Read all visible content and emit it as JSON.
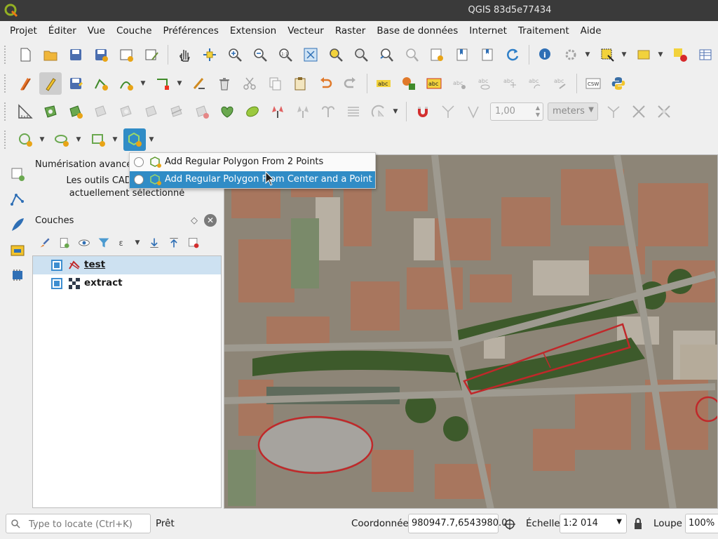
{
  "window": {
    "title": "QGIS 83d5e77434"
  },
  "menu": [
    "Projet",
    "Éditer",
    "Vue",
    "Couche",
    "Préférences",
    "Extension",
    "Vecteur",
    "Raster",
    "Base de données",
    "Internet",
    "Traitement",
    "Aide"
  ],
  "toolbar3": {
    "offset_value": "1,00",
    "units": "meters"
  },
  "cad_panel": {
    "title": "Numérisation avancée",
    "message_line1": "Les outils CAD ne sont pas",
    "message_line2": "actuellement sélectionné"
  },
  "layers_panel": {
    "title": "Couches",
    "layers": [
      {
        "name": "test",
        "checked": true,
        "selected": true,
        "icon": "line-layer-icon"
      },
      {
        "name": "extract",
        "checked": true,
        "selected": false,
        "icon": "raster-layer-icon"
      }
    ]
  },
  "regular_polygon_menu": {
    "items": [
      {
        "label": "Add Regular Polygon From 2 Points",
        "highlighted": false
      },
      {
        "label": "Add Regular Polygon From Center and a Point",
        "highlighted": true
      }
    ]
  },
  "statusbar": {
    "locate_placeholder": "Type to locate (Ctrl+K)",
    "status_text": "Prêt",
    "coordinate_label": "Coordonnée",
    "coordinate_value": "980947.7,6543980.0",
    "scale_label": "Échelle",
    "scale_value": "1:2 014",
    "magnifier_label": "Loupe",
    "magnifier_value": "100%"
  },
  "colors": {
    "accent": "#308cc6",
    "digitized_feature": "#c0282a",
    "selected_row": "#cde1f1"
  }
}
